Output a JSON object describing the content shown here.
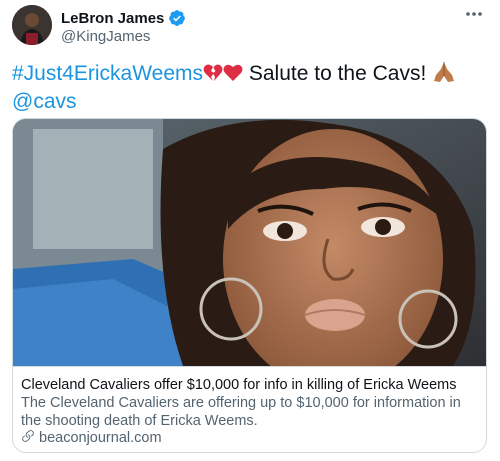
{
  "user": {
    "display_name": "LeBron James",
    "handle": "@KingJames",
    "verified": true
  },
  "tweet": {
    "hashtag": "#Just4ErickaWeems",
    "emoji_1": "broken-heart",
    "emoji_2": "red-heart",
    "text": " Salute to the Cavs! ",
    "emoji_3": "folded-hands",
    "mention": "@cavs"
  },
  "card": {
    "image": "photo-of-woman-selfie-in-car",
    "title": "Cleveland Cavaliers offer $10,000 for info in killing of Ericka Weems",
    "description": "The Cleveland Cavaliers are offering up to $10,000 for information in the shooting death of Ericka Weems.",
    "domain": "beaconjournal.com"
  },
  "colors": {
    "link": "#1b95e0",
    "verified": "#1d9bf0",
    "secondary_text": "#536471",
    "border": "#cfd9de"
  }
}
